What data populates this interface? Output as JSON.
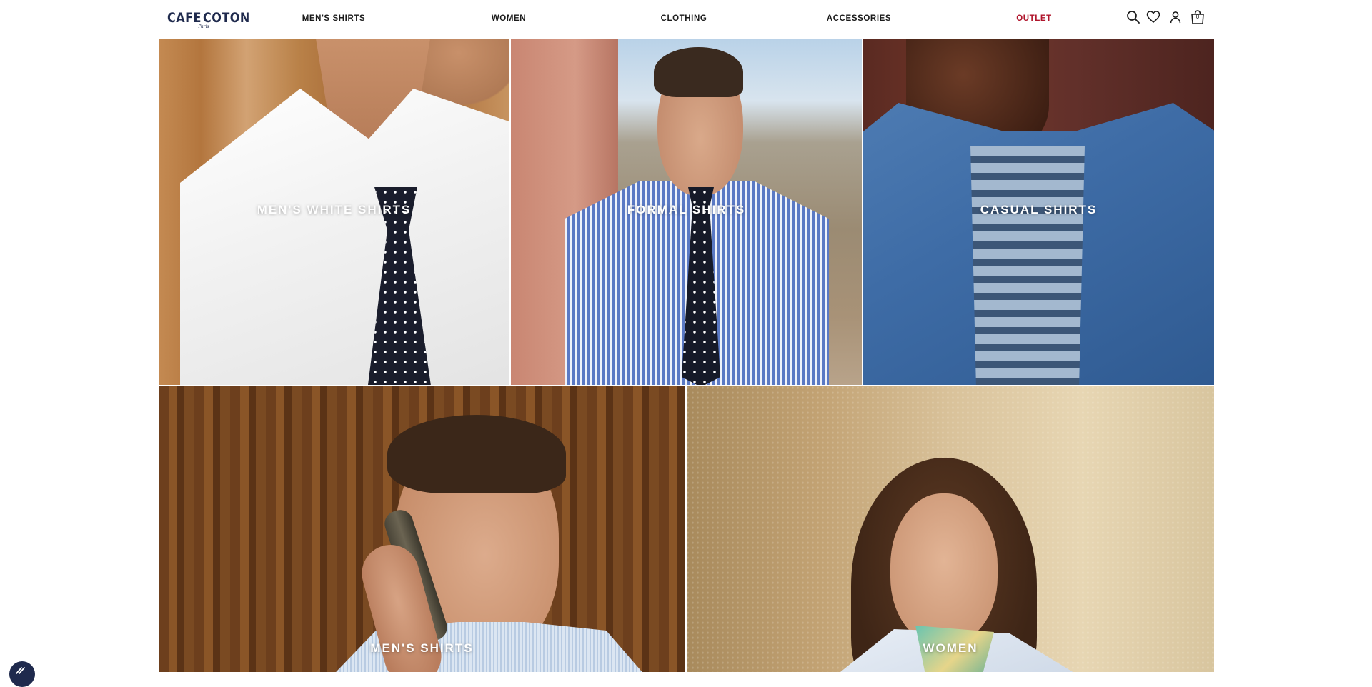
{
  "brand": {
    "logo_left": "CAFE",
    "logo_right": "COTON",
    "logo_sub": "Paris",
    "logo_color": "#1f2a4d"
  },
  "nav": {
    "items": [
      {
        "label": "MEN'S SHIRTS"
      },
      {
        "label": "WOMEN"
      },
      {
        "label": "CLOTHING"
      },
      {
        "label": "ACCESSORIES"
      },
      {
        "label": "OUTLET",
        "color": "#b0152c"
      }
    ]
  },
  "header_icons": {
    "search": "search-icon",
    "wishlist": "heart-icon",
    "account": "user-icon",
    "cart": "shopping-bag-icon",
    "cart_count": "0"
  },
  "tiles": [
    {
      "label": "MEN'S WHITE SHIRTS"
    },
    {
      "label": "FORMAL SHIRTS"
    },
    {
      "label": "CASUAL SHIRTS"
    },
    {
      "label": "MEN'S SHIRTS"
    },
    {
      "label": "WOMEN"
    }
  ],
  "floating": {
    "cookie_icon": "cookie-settings-icon"
  }
}
